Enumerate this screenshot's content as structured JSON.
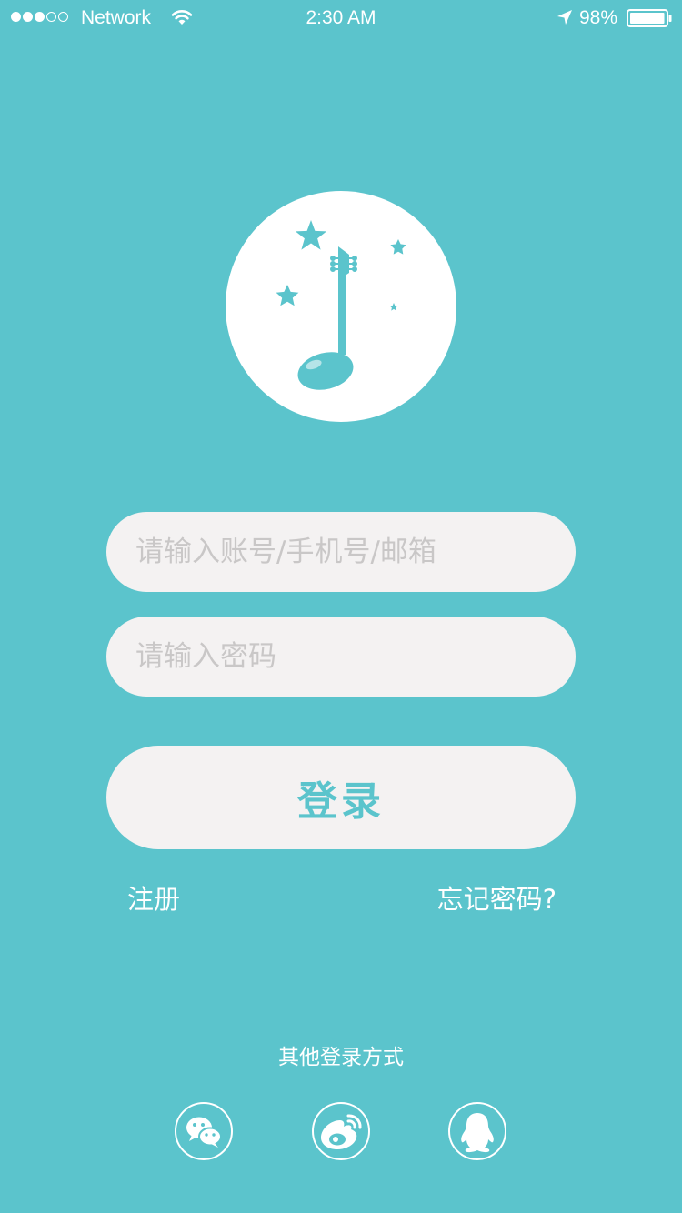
{
  "status_bar": {
    "carrier": "Network",
    "time": "2:30 AM",
    "battery": "98%",
    "signal_icon": "signal-dots-icon",
    "wifi_icon": "wifi-icon",
    "location_icon": "location-arrow-icon",
    "battery_icon": "battery-icon"
  },
  "logo": {
    "icon": "music-note-guitar-icon"
  },
  "form": {
    "account_placeholder": "请输入账号/手机号/邮箱",
    "account_value": "",
    "password_placeholder": "请输入密码",
    "password_value": "",
    "login_label": "登录"
  },
  "links": {
    "register": "注册",
    "forgot_password": "忘记密码?"
  },
  "other_login": {
    "title": "其他登录方式",
    "providers": [
      {
        "icon": "wechat-icon"
      },
      {
        "icon": "weibo-icon"
      },
      {
        "icon": "qq-icon"
      }
    ]
  },
  "colors": {
    "background": "#5bc4cc",
    "field_background": "#f4f2f2",
    "accent": "#5bc4cc",
    "placeholder": "#c9c7c7",
    "text_light": "#ffffff"
  }
}
